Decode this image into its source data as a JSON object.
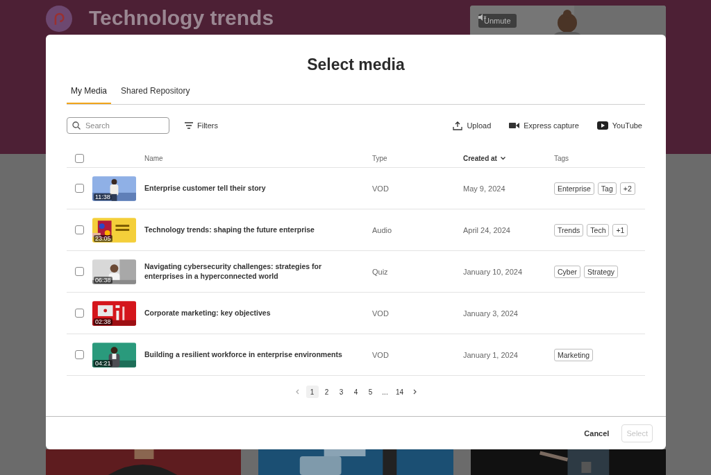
{
  "background": {
    "title": "Technology trends",
    "unmute_button": "Unmute"
  },
  "dialog": {
    "title": "Select media",
    "tabs": [
      {
        "label": "My Media",
        "selected": true
      },
      {
        "label": "Shared Repository",
        "selected": false
      }
    ],
    "search": {
      "placeholder": "Search"
    },
    "filters_button": "Filters",
    "actions": [
      {
        "kind": "upload",
        "label": "Upload"
      },
      {
        "kind": "camera",
        "label": "Express capture"
      },
      {
        "kind": "youtube",
        "label": "YouTube"
      }
    ],
    "table": {
      "select_all_checked": false,
      "columns": [
        {
          "label": "Name",
          "sorted": false
        },
        {
          "label": "Type",
          "sorted": false
        },
        {
          "label": "Created at",
          "sorted": true
        },
        {
          "label": "Tags",
          "sorted": false
        }
      ],
      "rows": [
        {
          "checked": false,
          "duration": "11:38",
          "name": "Enterprise customer tell their story",
          "type": "VOD",
          "created": "May 9, 2024",
          "tags": [
            "Enterprise",
            "Tag",
            "+2"
          ]
        },
        {
          "checked": false,
          "duration": "23:05",
          "name": "Technology trends: shaping the future enterprise",
          "type": "Audio",
          "created": "April 24, 2024",
          "tags": [
            "Trends",
            "Tech",
            "+1"
          ]
        },
        {
          "checked": false,
          "duration": "06:38",
          "name": "Navigating cybersecurity challenges: strategies for enterprises in a hyperconnected world",
          "type": "Quiz",
          "created": "January 10, 2024",
          "tags": [
            "Cyber",
            "Strategy"
          ]
        },
        {
          "checked": false,
          "duration": "02:38",
          "name": "Corporate marketing: key objectives",
          "type": "VOD",
          "created": "January 3, 2024",
          "tags": []
        },
        {
          "checked": false,
          "duration": "04:21",
          "name": "Building a resilient workforce in enterprise environments",
          "type": "VOD",
          "created": "January 1, 2024",
          "tags": [
            "Marketing"
          ]
        }
      ]
    },
    "pagination": {
      "pages": [
        {
          "label": "1",
          "selected": true
        },
        {
          "label": "2",
          "selected": false
        },
        {
          "label": "3",
          "selected": false
        },
        {
          "label": "4",
          "selected": false
        },
        {
          "label": "5",
          "selected": false
        },
        {
          "label": "...",
          "selected": false
        },
        {
          "label": "14",
          "selected": false
        }
      ]
    },
    "footer": {
      "cancel": "Cancel",
      "select": {
        "label": "Select",
        "disabled": true
      }
    }
  }
}
